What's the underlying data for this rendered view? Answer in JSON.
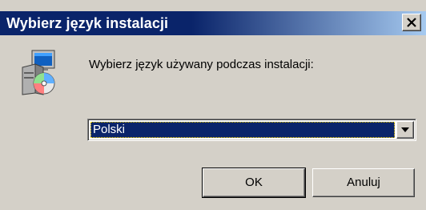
{
  "window": {
    "title": "Wybierz język instalacji",
    "close_label": "×"
  },
  "icon": {
    "name": "installer-setup-icon"
  },
  "prompt": "Wybierz język używany podczas instalacji:",
  "language_select": {
    "selected": "Polski"
  },
  "buttons": {
    "ok": "OK",
    "cancel": "Anuluj"
  },
  "colors": {
    "title_bar": "#0a246a",
    "dialog_bg": "#d4d0c8",
    "selection_bg": "#0a246a"
  }
}
